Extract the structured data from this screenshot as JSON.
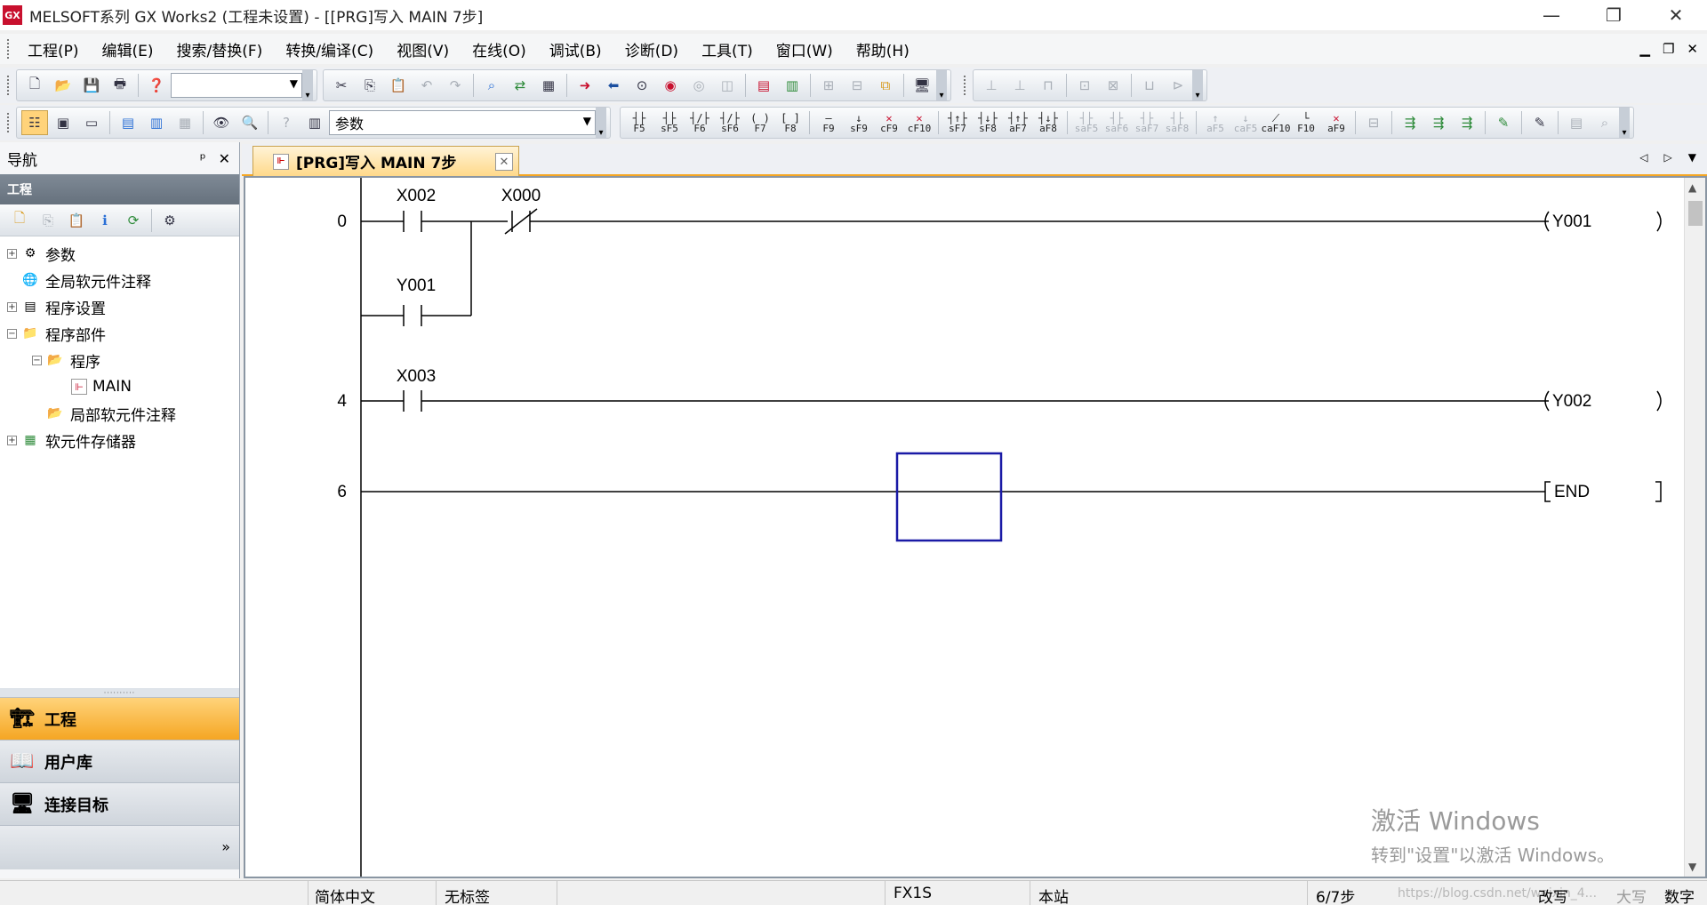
{
  "window": {
    "title": "MELSOFT系列 GX Works2 (工程未设置) - [[PRG]写入 MAIN 7步]",
    "app_icon_text": "GX",
    "minimize": "—",
    "restore": "❐",
    "close": "✕"
  },
  "menu": [
    "工程(P)",
    "编辑(E)",
    "搜索/替换(F)",
    "转换/编译(C)",
    "视图(V)",
    "在线(O)",
    "调试(B)",
    "诊断(D)",
    "工具(T)",
    "窗口(W)",
    "帮助(H)"
  ],
  "toolbar": {
    "combo1_value": "",
    "combo2_value": "参数",
    "ladder_keys": [
      "F5",
      "sF5",
      "F6",
      "sF6",
      "F7",
      "F8",
      "F9",
      "sF9",
      "cF9",
      "cF10",
      "sF7",
      "sF8",
      "aF7",
      "aF8",
      "saF5",
      "saF6",
      "saF7",
      "saF8",
      "aF5",
      "caF5",
      "caF10",
      "F10",
      "aF9"
    ]
  },
  "navigation": {
    "title": "导航",
    "pin": "ᵖ",
    "close": "✕",
    "section": "工程",
    "tree": [
      {
        "label": "参数",
        "indent": 0,
        "expander": "+"
      },
      {
        "label": "全局软元件注释",
        "indent": 0,
        "expander": ""
      },
      {
        "label": "程序设置",
        "indent": 0,
        "expander": "+"
      },
      {
        "label": "程序部件",
        "indent": 0,
        "expander": "−"
      },
      {
        "label": "程序",
        "indent": 1,
        "expander": "−"
      },
      {
        "label": "MAIN",
        "indent": 2,
        "expander": ""
      },
      {
        "label": "局部软元件注释",
        "indent": 1,
        "expander": ""
      },
      {
        "label": "软元件存储器",
        "indent": 0,
        "expander": "+"
      }
    ],
    "bottom_buttons": [
      "工程",
      "用户库",
      "连接目标"
    ],
    "more": "»"
  },
  "editor": {
    "tab_label": "[PRG]写入 MAIN 7步",
    "tab_close": "✕",
    "ladder": {
      "rungs": [
        {
          "step": "0",
          "contacts": [
            "X002",
            "X000"
          ],
          "branch": "Y001",
          "coil": "Y001"
        },
        {
          "step": "4",
          "contacts": [
            "X003"
          ],
          "coil": "Y002"
        },
        {
          "step": "6",
          "coil": "END"
        }
      ]
    }
  },
  "watermark": {
    "line1": "激活 Windows",
    "line2": "转到\"设置\"以激活 Windows。"
  },
  "status": {
    "language": "简体中文",
    "label": "无标签",
    "plc": "FX1S",
    "station": "本站",
    "steps": "6/7步",
    "url": "https://blog.csdn.net/weixin_4...",
    "mode": "改写",
    "caps": "大写",
    "num": "数字"
  }
}
